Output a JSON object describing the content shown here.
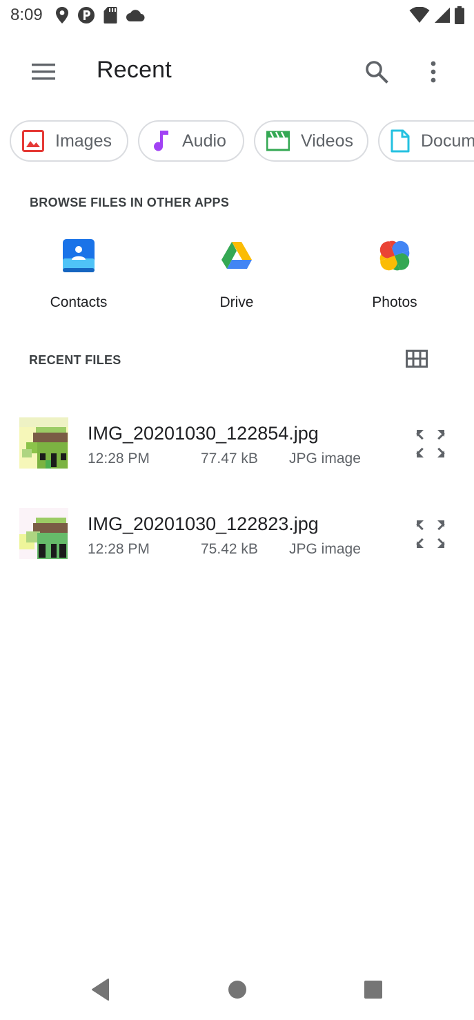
{
  "status_bar": {
    "time": "8:09",
    "left_icons": [
      "location-icon",
      "p-circle-icon",
      "sd-card-icon",
      "cloud-icon"
    ],
    "right_icons": [
      "wifi-icon",
      "cell-signal-icon",
      "battery-icon"
    ]
  },
  "app_bar": {
    "title": "Recent",
    "menu_icon": "hamburger-menu-icon",
    "search_icon": "search-icon",
    "more_icon": "more-vert-icon"
  },
  "chips": [
    {
      "label": "Images",
      "icon": "image-icon",
      "color": "#e53935"
    },
    {
      "label": "Audio",
      "icon": "music-note-icon",
      "color": "#a142f4"
    },
    {
      "label": "Videos",
      "icon": "movie-clapper-icon",
      "color": "#34a853"
    },
    {
      "label": "Docum",
      "icon": "document-icon",
      "color": "#24c1e0"
    }
  ],
  "browse_section": {
    "header": "BROWSE FILES IN OTHER APPS",
    "apps": [
      {
        "label": "Contacts",
        "icon": "contacts-app-icon"
      },
      {
        "label": "Drive",
        "icon": "drive-app-icon"
      },
      {
        "label": "Photos",
        "icon": "photos-app-icon"
      }
    ]
  },
  "recent_section": {
    "header": "RECENT FILES",
    "view_toggle_icon": "grid-view-icon",
    "files": [
      {
        "name": "IMG_20201030_122854.jpg",
        "time": "12:28 PM",
        "size": "77.47 kB",
        "type": "JPG image",
        "action_icon": "expand-icon"
      },
      {
        "name": "IMG_20201030_122823.jpg",
        "time": "12:28 PM",
        "size": "75.42 kB",
        "type": "JPG image",
        "action_icon": "expand-icon"
      }
    ]
  },
  "nav_bar": {
    "back_icon": "back-triangle-icon",
    "home_icon": "home-circle-icon",
    "recents_icon": "recents-square-icon"
  }
}
